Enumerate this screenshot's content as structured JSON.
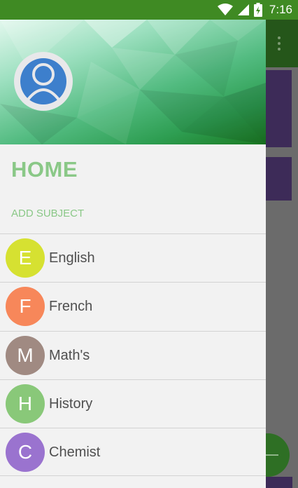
{
  "status_bar": {
    "time": "7:16",
    "icons": [
      "wifi-icon",
      "signal-icon",
      "battery-icon"
    ]
  },
  "drawer": {
    "home_title": "HOME",
    "add_subject_label": "ADD SUBJECT",
    "subjects": [
      {
        "initial": "E",
        "name": "English",
        "color": "#d6e131"
      },
      {
        "initial": "F",
        "name": "French",
        "color": "#f7875a"
      },
      {
        "initial": "M",
        "name": "Math's",
        "color": "#a08a82"
      },
      {
        "initial": "H",
        "name": "History",
        "color": "#89c879"
      },
      {
        "initial": "C",
        "name": "Chemist",
        "color": "#9a73cf"
      }
    ]
  },
  "colors": {
    "status_bar": "#3f8a23",
    "accent_text": "#8ac887",
    "drawer_bg": "#f2f2f2"
  }
}
